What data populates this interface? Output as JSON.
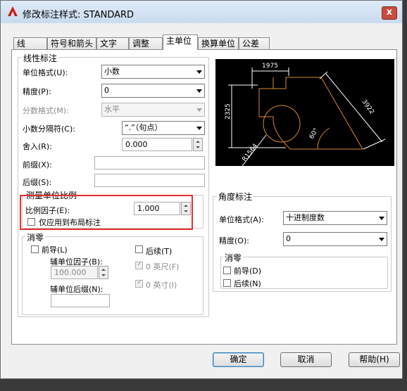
{
  "window": {
    "title": "修改标注样式: STANDARD",
    "close": "x"
  },
  "tabs": [
    {
      "label": "线"
    },
    {
      "label": "符号和箭头"
    },
    {
      "label": "文字"
    },
    {
      "label": "调整"
    },
    {
      "label": "主单位"
    },
    {
      "label": "换算单位"
    },
    {
      "label": "公差"
    }
  ],
  "linear": {
    "title": "线性标注",
    "unit_format_label": "单位格式(U):",
    "unit_format_value": "小数",
    "precision_label": "精度(P):",
    "precision_value": "0",
    "fraction_format_label": "分数格式(M):",
    "fraction_format_value": "水平",
    "decimal_sep_label": "小数分隔符(C):",
    "decimal_sep_value": "“.”（句点）",
    "roundoff_label": "舍入(R):",
    "roundoff_value": "0.000",
    "prefix_label": "前缀(X):",
    "prefix_value": "",
    "suffix_label": "后缀(S):",
    "suffix_value": ""
  },
  "scale": {
    "title": "测量单位比例",
    "factor_label": "比例因子(E):",
    "factor_value": "1.000",
    "layout_only_label": "仅应用到布局标注"
  },
  "zero_sup": {
    "title": "消零",
    "leading_label": "前导(L)",
    "sub_factor_label": "辅单位因子(B):",
    "sub_factor_value": "100.000",
    "sub_suffix_label": "辅单位后缀(N):",
    "sub_suffix_value": "",
    "trailing_label": "后续(T)",
    "feet_label": "0 英尺(F)",
    "inches_label": "0 英寸(I)"
  },
  "angular": {
    "title": "角度标注",
    "unit_format_label": "单位格式(A):",
    "unit_format_value": "十进制度数",
    "precision_label": "精度(O):",
    "precision_value": "0",
    "zero_title": "消零",
    "leading_label": "前导(D)",
    "trailing_label": "后续(N)"
  },
  "preview": {
    "dim_top": "1975",
    "dim_left": "2325",
    "dim_right": "3922",
    "dim_angle": "60°",
    "dim_radius": "R1564"
  },
  "buttons": {
    "ok": "确定",
    "cancel": "取消",
    "help": "帮助(H)"
  },
  "colors": {
    "highlight": "#e53030",
    "preview_bg": "#000000",
    "geometry": "#d98a2b"
  }
}
